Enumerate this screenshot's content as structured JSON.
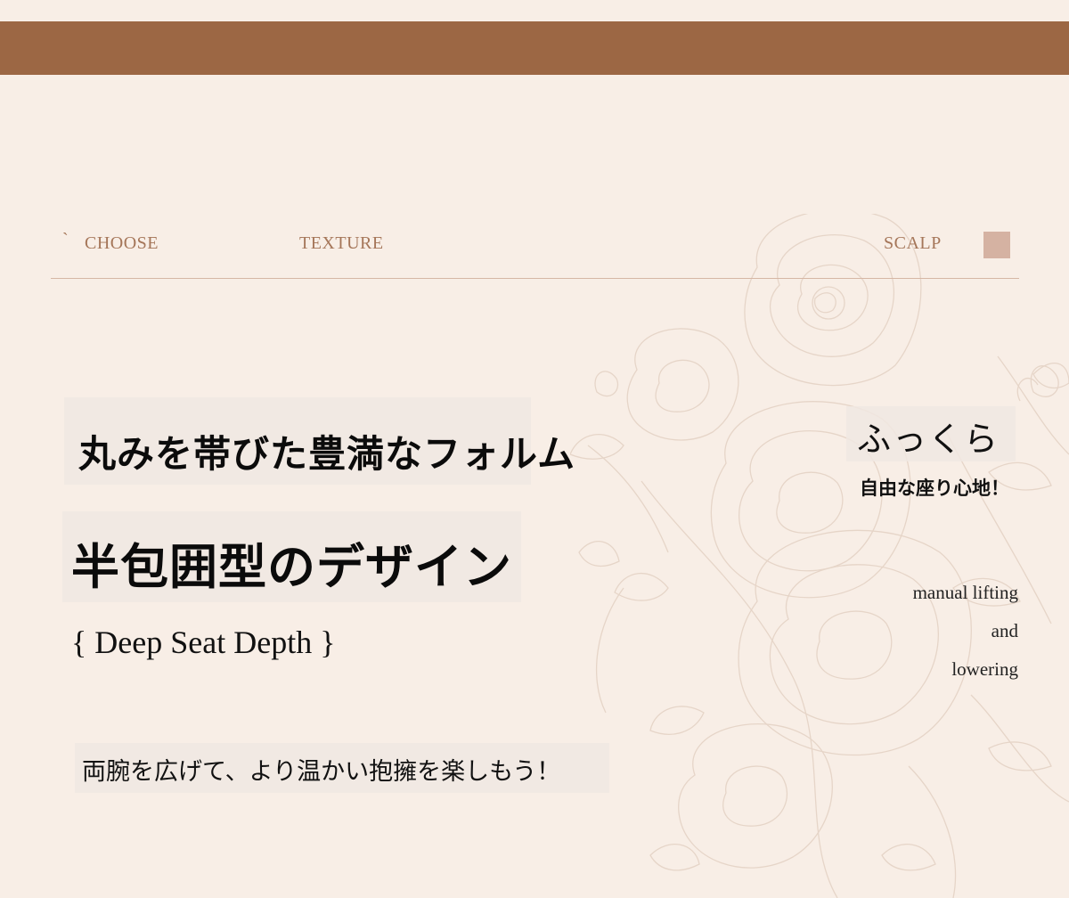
{
  "colors": {
    "background": "#f8eee6",
    "top_band": "#9c6744",
    "nav_text": "#a57659",
    "nav_square": "#d5b2a2",
    "nav_rule": "#d6b7a5",
    "rose_outline": "#e6d5c8",
    "body_text": "#111111"
  },
  "nav": {
    "tick": "`",
    "choose": "CHOOSE",
    "texture": "TEXTURE",
    "scalp": "SCALP"
  },
  "left": {
    "headline_1": "丸みを帯びた豊満なフォルム",
    "headline_2": "半包囲型のデザイン",
    "seat_depth": "{ Deep Seat Depth }",
    "embrace": "両腕を広げて、より温かい抱擁を楽しもう！"
  },
  "right": {
    "fukkura": "ふっくら",
    "free_seat": "自由な座り心地！",
    "manual_lines": [
      "manual lifting",
      "and",
      "lowering"
    ]
  },
  "icons": {
    "decoration": "rose-line-art-icon",
    "nav_marker": "square-marker-icon"
  }
}
